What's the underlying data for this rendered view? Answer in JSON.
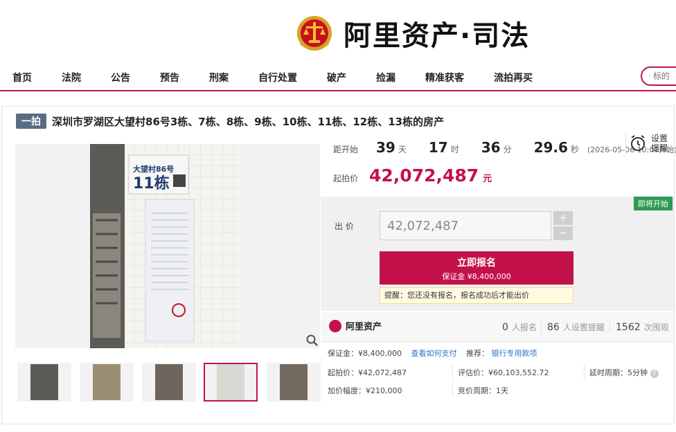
{
  "header": {
    "brand": "阿里资产·司法"
  },
  "nav": {
    "items": [
      "首页",
      "法院",
      "公告",
      "预告",
      "刑案",
      "自行处置",
      "破产",
      "捡漏",
      "精准获客",
      "流拍再买"
    ],
    "search_placeholder": "标的"
  },
  "auction": {
    "tag": "一拍",
    "title": "深圳市罗湖区大望村86号3栋、7栋、8栋、9栋、10栋、11栋、12栋、13栋的房产",
    "photo_sign_line1": "大望村86号",
    "photo_sign_line2": "11栋",
    "photo_sign_small": "栋"
  },
  "countdown": {
    "label": "距开始",
    "days": "39",
    "days_unit": "天",
    "hours": "17",
    "hours_unit": "时",
    "minutes": "36",
    "minutes_unit": "分",
    "seconds": "29.6",
    "seconds_unit": "秒",
    "start_note": "(2026-05-06 10:00开始)"
  },
  "reminder": {
    "line1": "设置",
    "line2": "提醒"
  },
  "price": {
    "label": "起拍价",
    "value": "42,072,487",
    "unit": "元"
  },
  "bid": {
    "badge": "即将开始",
    "label": "出  价",
    "value": "42,072,487",
    "plus": "+",
    "minus": "−",
    "signup_label": "立即报名",
    "deposit_label": "保证金 ¥8,400,000",
    "tip": "提醒：您还没有报名，报名成功后才能出价"
  },
  "stats": {
    "brand": "阿里资产",
    "registered_num": "0",
    "registered_txt": "人报名",
    "reminder_num": "86",
    "reminder_txt": "人设置提醒",
    "views_num": "1562",
    "views_txt": "次围观"
  },
  "details": {
    "deposit": "保证金：¥8,400,000",
    "how_to_pay": "查看如何支付",
    "recommend_label": "推荐：",
    "recommend_link": "银行专用款项",
    "start_price": "起拍价：¥42,072,487",
    "appraisal": "评估价：¥60,103,552.72",
    "delay": "延时周期：5分钟",
    "increment": "加价幅度：¥210,000",
    "cycle": "竞价周期：1天",
    "help": "?"
  },
  "colors": {
    "accent": "#c3124a",
    "badge": "#2f9a51",
    "tag": "#5a6b85",
    "link": "#2a73c8"
  }
}
